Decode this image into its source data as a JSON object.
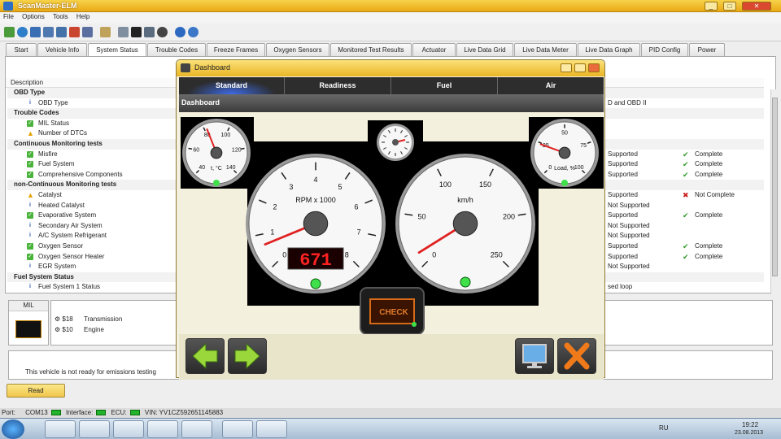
{
  "app": {
    "title": "ScanMaster-ELM"
  },
  "menu": [
    "File",
    "Options",
    "Tools",
    "Help"
  ],
  "tabs": [
    "Start",
    "Vehicle Info",
    "System Status",
    "Trouble Codes",
    "Freeze Frames",
    "Oxygen Sensors",
    "Monitored Test Results",
    "Actuator",
    "Live Data Grid",
    "Live Data Meter",
    "Live Data Graph",
    "PID Config",
    "Power"
  ],
  "active_tab": "System Status",
  "table": {
    "header": "Description",
    "rows": [
      {
        "type": "group",
        "label": "OBD Type"
      },
      {
        "type": "item",
        "icon": "info",
        "label": "OBD Type",
        "status": "D and OBD II",
        "mark": "",
        "complete": ""
      },
      {
        "type": "group",
        "label": "Trouble Codes"
      },
      {
        "type": "item",
        "icon": "ok",
        "label": "MIL Status",
        "status": "",
        "mark": "",
        "complete": ""
      },
      {
        "type": "item",
        "icon": "warn",
        "label": "Number of DTCs",
        "status": "",
        "mark": "",
        "complete": ""
      },
      {
        "type": "group",
        "label": "Continuous Monitoring tests"
      },
      {
        "type": "item",
        "icon": "ok",
        "label": "Misfire",
        "status": "Supported",
        "mark": "ok",
        "complete": "Complete"
      },
      {
        "type": "item",
        "icon": "ok",
        "label": "Fuel System",
        "status": "Supported",
        "mark": "ok",
        "complete": "Complete"
      },
      {
        "type": "item",
        "icon": "ok",
        "label": "Comprehensive Components",
        "status": "Supported",
        "mark": "ok",
        "complete": "Complete"
      },
      {
        "type": "group",
        "label": "non-Continuous Monitoring tests"
      },
      {
        "type": "item",
        "icon": "warn",
        "label": "Catalyst",
        "status": "Supported",
        "mark": "x",
        "complete": "Not Complete"
      },
      {
        "type": "item",
        "icon": "info",
        "label": "Heated Catalyst",
        "status": "Not Supported",
        "mark": "",
        "complete": ""
      },
      {
        "type": "item",
        "icon": "ok",
        "label": "Evaporative System",
        "status": "Supported",
        "mark": "ok",
        "complete": "Complete"
      },
      {
        "type": "item",
        "icon": "info",
        "label": "Secondary Air System",
        "status": "Not Supported",
        "mark": "",
        "complete": ""
      },
      {
        "type": "item",
        "icon": "info",
        "label": "A/C System Refrigerant",
        "status": "Not Supported",
        "mark": "",
        "complete": ""
      },
      {
        "type": "item",
        "icon": "ok",
        "label": "Oxygen Sensor",
        "status": "Supported",
        "mark": "ok",
        "complete": "Complete"
      },
      {
        "type": "item",
        "icon": "ok",
        "label": "Oxygen Sensor Heater",
        "status": "Supported",
        "mark": "ok",
        "complete": "Complete"
      },
      {
        "type": "item",
        "icon": "info",
        "label": "EGR System",
        "status": "Not Supported",
        "mark": "",
        "complete": ""
      },
      {
        "type": "group",
        "label": "Fuel System Status"
      },
      {
        "type": "item",
        "icon": "info",
        "label": "Fuel System 1 Status",
        "status": "sed loop",
        "mark": "",
        "complete": ""
      }
    ]
  },
  "mil": {
    "label": "MIL",
    "codes": [
      {
        "code": "$18",
        "desc": "Transmission"
      },
      {
        "code": "$10",
        "desc": "Engine"
      }
    ]
  },
  "emissions_message": "This vehicle is not ready for emissions testing",
  "read_button": "Read",
  "statusbar": {
    "port_label": "Port:",
    "port": "COM13",
    "interface_label": "Interface:",
    "ecu_label": "ECU:",
    "vin": "VIN: YV1CZ592651145883"
  },
  "dashboard": {
    "title": "Dashboard",
    "tabs": [
      "Standard",
      "Readiness",
      "Fuel",
      "Air"
    ],
    "active_tab": "Standard",
    "subtitle": "Dashboard",
    "gauges": {
      "temp": {
        "label": "t, °C",
        "ticks": [
          "40",
          "60",
          "80",
          "100",
          "120",
          "140"
        ],
        "value": 82
      },
      "rpm": {
        "label": "RPM x 1000",
        "ticks": [
          "0",
          "1",
          "2",
          "3",
          "4",
          "5",
          "6",
          "7",
          "8"
        ],
        "value": 0.67,
        "digital": "671"
      },
      "speed": {
        "label": "km/h",
        "ticks": [
          "0",
          "50",
          "100",
          "150",
          "200",
          "250"
        ],
        "value": 12
      },
      "load": {
        "label": "Load, %",
        "ticks": [
          "0",
          "25",
          "50",
          "75",
          "100"
        ],
        "value": 24
      }
    },
    "check_label": "CHECK"
  },
  "taskbar": {
    "lang": "RU",
    "time": "19:22",
    "date": "23.08.2013"
  }
}
